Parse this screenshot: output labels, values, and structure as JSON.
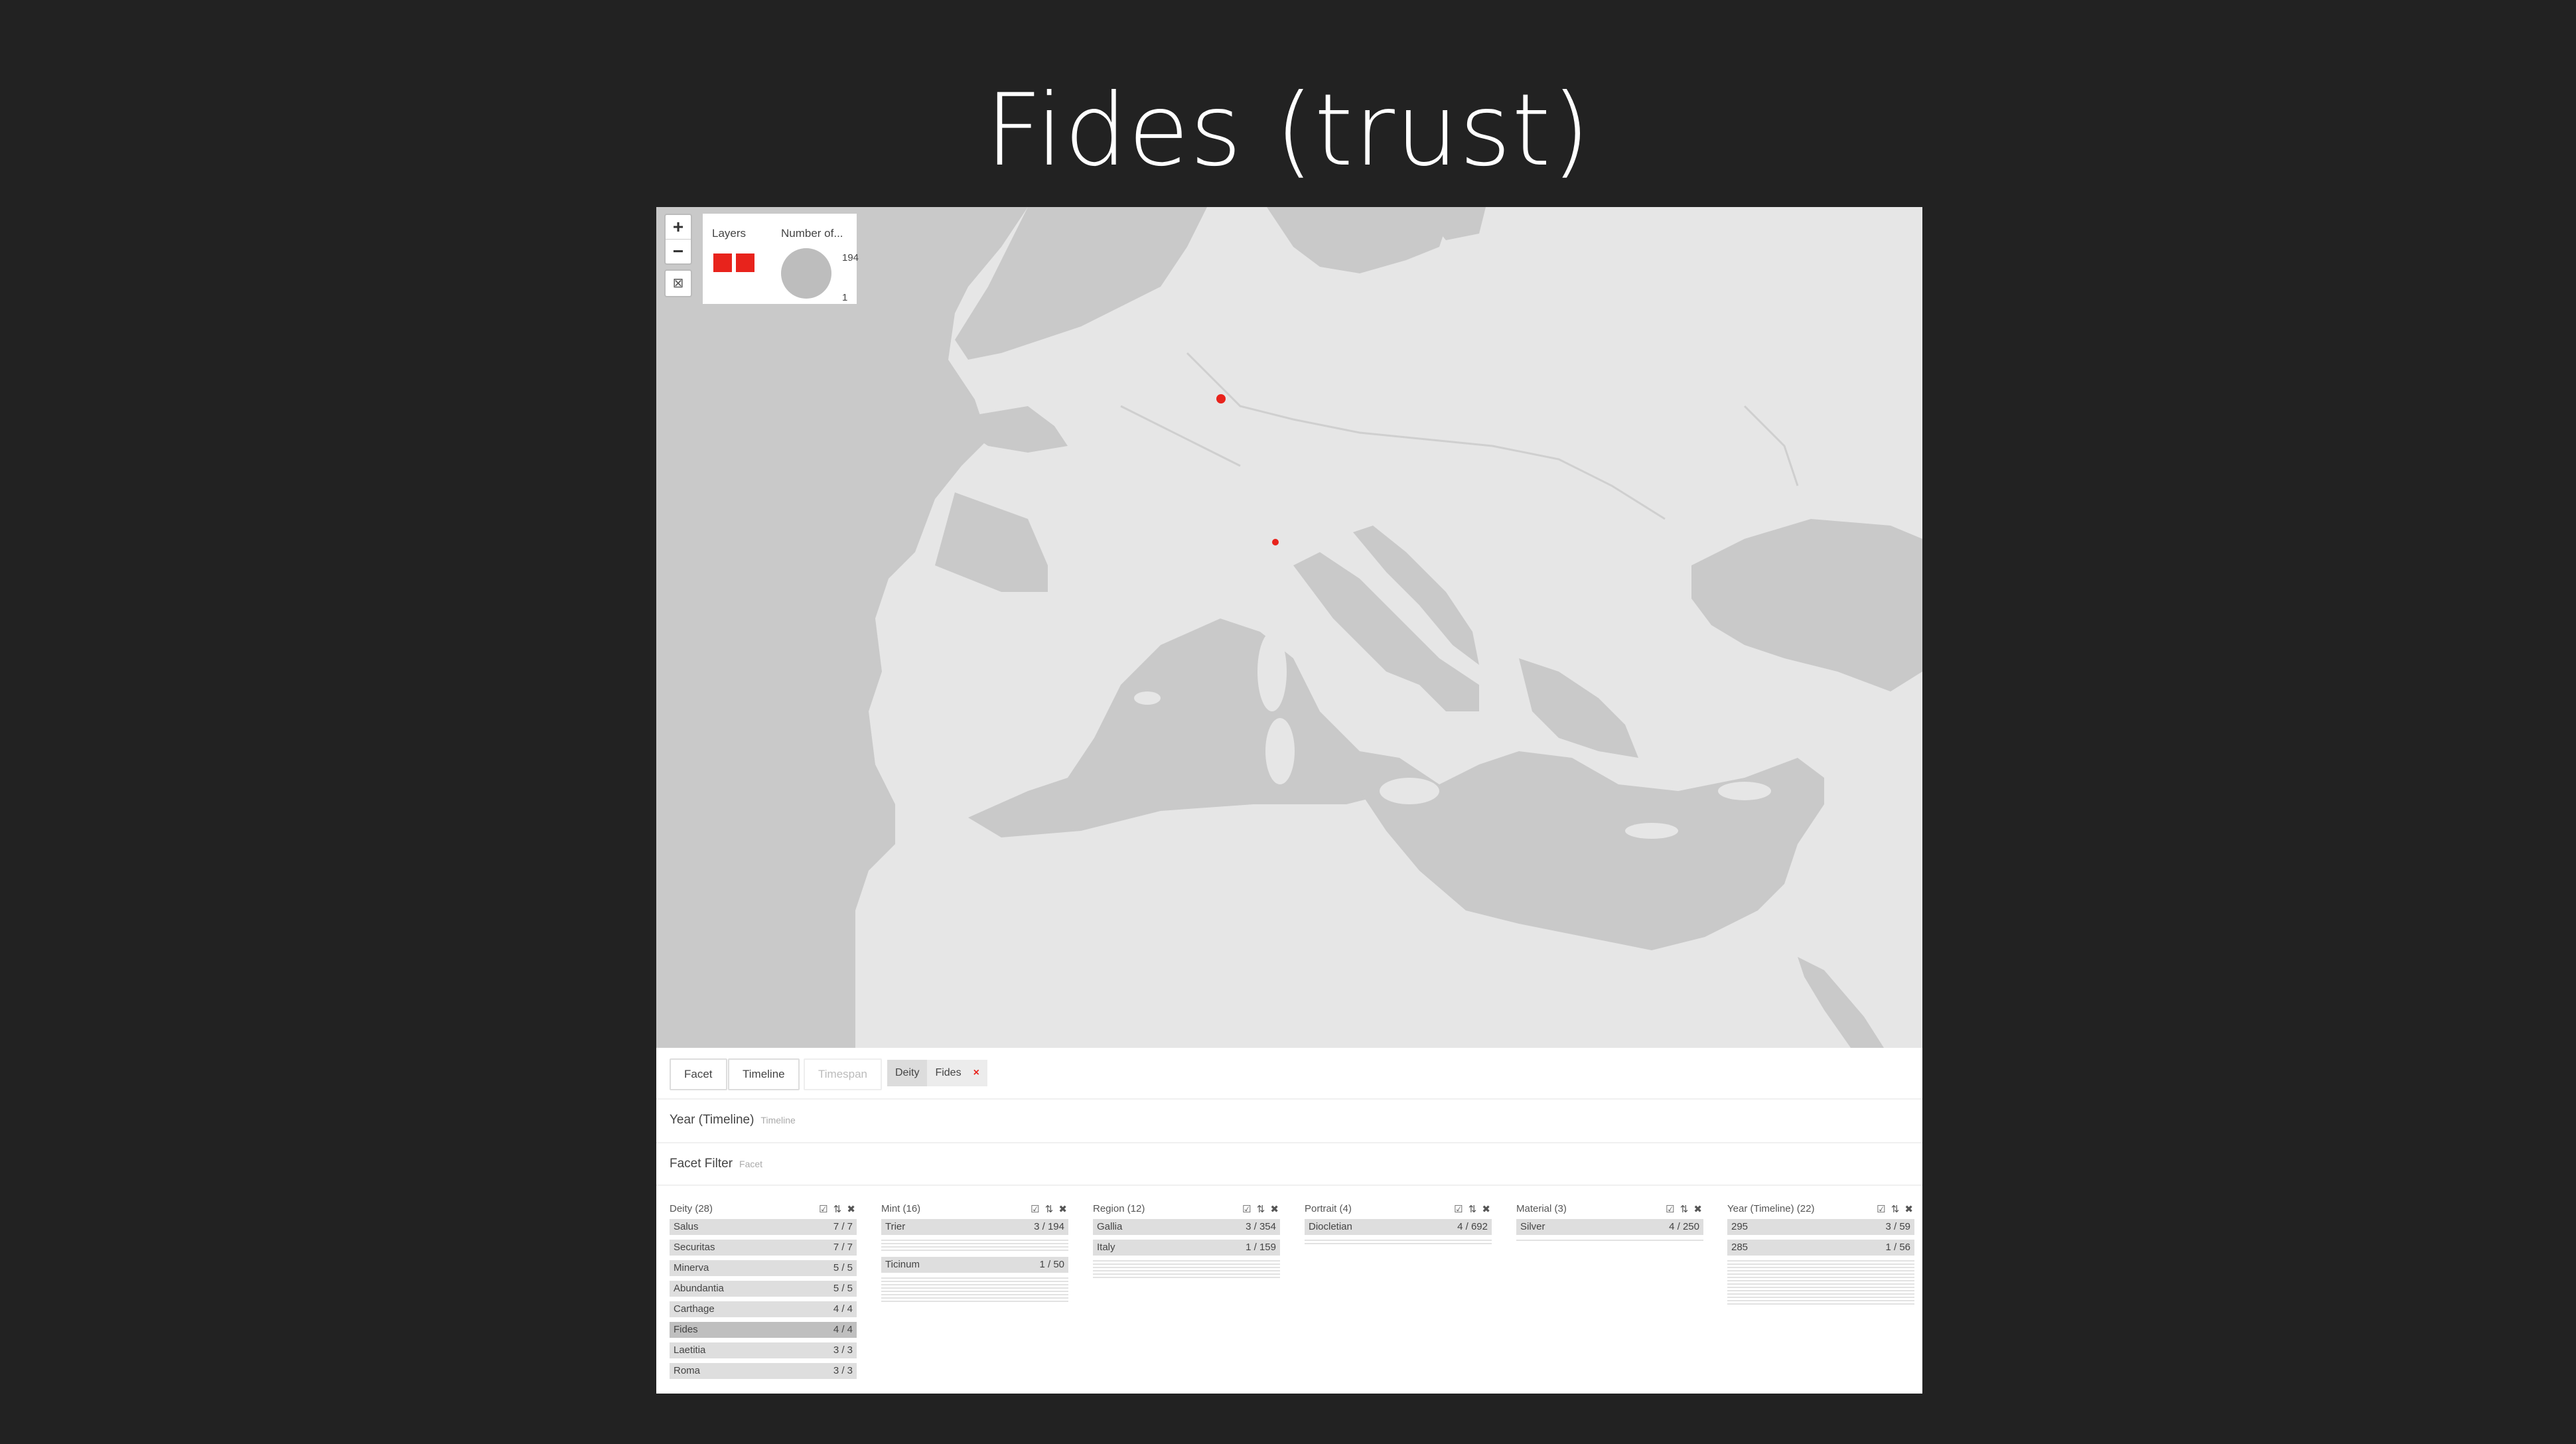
{
  "slide": {
    "title": "Fides (trust)"
  },
  "map": {
    "zoom_in": "+",
    "zoom_out": "−",
    "legend": {
      "layers_label": "Layers",
      "number_label": "Number of...",
      "max_value": "194",
      "min_value": "1"
    },
    "points": [
      {
        "name": "Trier"
      },
      {
        "name": "Ticinum"
      }
    ]
  },
  "toolbar": {
    "facet_button": "Facet",
    "timeline_button": "Timeline",
    "timespan_button": "Timespan",
    "active_filter": {
      "key": "Deity",
      "value": "Fides",
      "remove": "×"
    }
  },
  "sections": {
    "year_title": "Year (Timeline)",
    "year_sub": "Timeline",
    "facet_title": "Facet Filter",
    "facet_sub": "Facet"
  },
  "facets": [
    {
      "title": "Deity (28)",
      "rows": [
        {
          "label": "Salus",
          "count": "7 / 7"
        },
        {
          "label": "Securitas",
          "count": "7 / 7"
        },
        {
          "label": "Minerva",
          "count": "5 / 5"
        },
        {
          "label": "Abundantia",
          "count": "5 / 5"
        },
        {
          "label": "Carthage",
          "count": "4 / 4"
        },
        {
          "label": "Fides",
          "count": "4 / 4",
          "selected": true
        },
        {
          "label": "Laetitia",
          "count": "3 / 3"
        },
        {
          "label": "Roma",
          "count": "3 / 3"
        }
      ]
    },
    {
      "title": "Mint (16)",
      "rows": [
        {
          "label": "Trier",
          "count": "3 / 194"
        },
        {
          "label": "Ticinum",
          "count": "1 / 50"
        }
      ]
    },
    {
      "title": "Region (12)",
      "rows": [
        {
          "label": "Gallia",
          "count": "3 / 354"
        },
        {
          "label": "Italy",
          "count": "1 / 159"
        }
      ]
    },
    {
      "title": "Portrait (4)",
      "rows": [
        {
          "label": "Diocletian",
          "count": "4 / 692"
        }
      ]
    },
    {
      "title": "Material (3)",
      "rows": [
        {
          "label": "Silver",
          "count": "4 / 250"
        }
      ]
    },
    {
      "title": "Year (Timeline) (22)",
      "rows": [
        {
          "label": "295",
          "count": "3 / 59"
        },
        {
          "label": "285",
          "count": "1 / 56"
        }
      ]
    }
  ],
  "icons": {
    "facet_header": "☑ ⇅ ✖"
  },
  "colors": {
    "accent": "#e8231c",
    "map_land": "#e5e5e5",
    "map_water": "#c8c8c8",
    "background": "#222222"
  }
}
